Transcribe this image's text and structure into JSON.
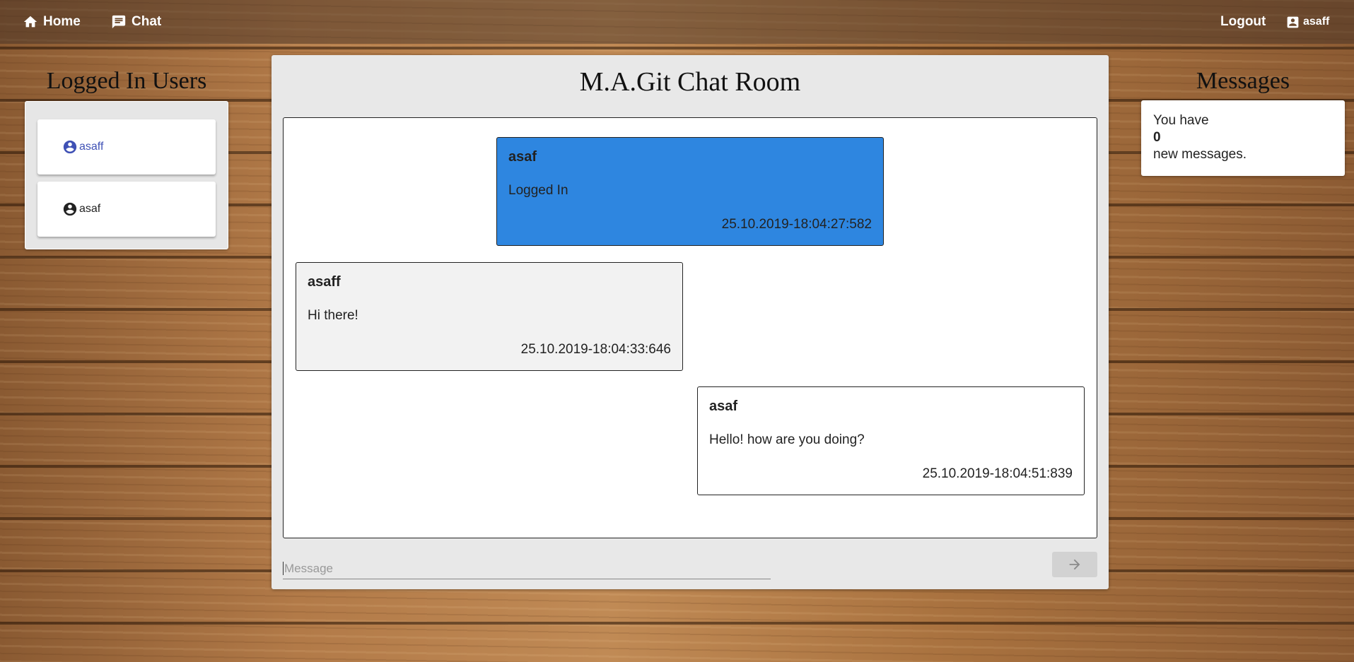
{
  "nav": {
    "home_label": "Home",
    "chat_label": "Chat",
    "logout_label": "Logout",
    "current_user": "asaff"
  },
  "users": {
    "title": "Logged In Users",
    "items": [
      {
        "name": "asaff",
        "is_self": true
      },
      {
        "name": "asaf",
        "is_self": false
      }
    ]
  },
  "chat": {
    "title": "M.A.Git Chat Room",
    "messages": [
      {
        "sender": "asaf",
        "text": "Logged In",
        "time": "25.10.2019-18:04:27:582",
        "style": "system"
      },
      {
        "sender": "asaff",
        "text": "Hi there!",
        "time": "25.10.2019-18:04:33:646",
        "style": "own"
      },
      {
        "sender": "asaf",
        "text": "Hello! how are you doing?",
        "time": "25.10.2019-18:04:51:839",
        "style": "other"
      }
    ],
    "input_placeholder": "Message",
    "input_value": ""
  },
  "messages_panel": {
    "title": "Messages",
    "line1": "You have",
    "count": "0",
    "line2": "new messages."
  },
  "colors": {
    "system_bubble": "#2e86e0",
    "own_bubble": "#f2f2f2",
    "other_bubble": "#ffffff",
    "self_user": "#3f51b5"
  },
  "icons": {
    "home": "home-icon",
    "chat": "chat-bubble-icon",
    "account": "account-box-icon",
    "user": "account-circle-icon",
    "send": "arrow-right-icon"
  }
}
